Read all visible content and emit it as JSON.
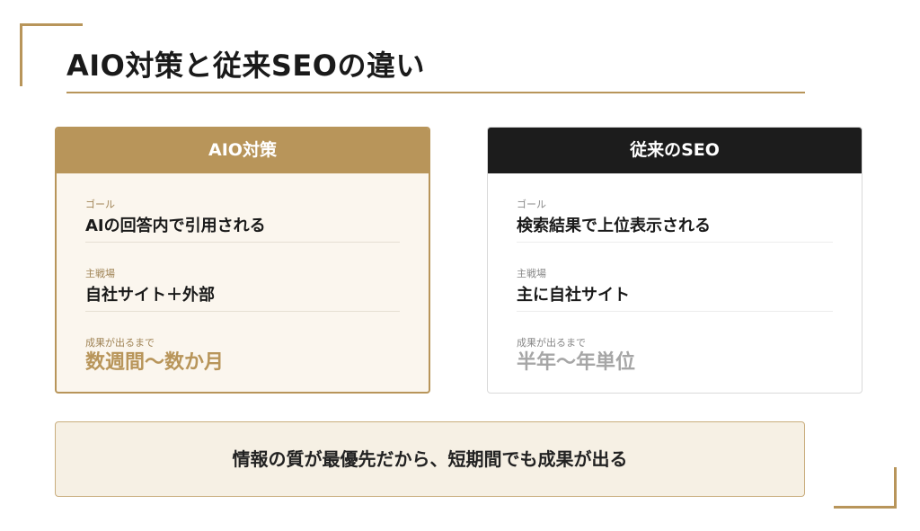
{
  "slide": {
    "title": "AIO対策と従来SEOの違い"
  },
  "cards": {
    "aio": {
      "header": "AIO対策",
      "goal_label": "ゴール",
      "goal_value": "AIの回答内で引用される",
      "field_label": "主戦場",
      "field_value": "自社サイト＋外部",
      "time_label": "成果が出るまで",
      "time_value": "数週間〜数か月"
    },
    "seo": {
      "header": "従来のSEO",
      "goal_label": "ゴール",
      "goal_value": "検索結果で上位表示される",
      "field_label": "主戦場",
      "field_value": "主に自社サイト",
      "time_label": "成果が出るまで",
      "time_value": "半年〜年単位"
    }
  },
  "banner": {
    "text": "情報の質が最優先だから、短期間でも成果が出る"
  },
  "colors": {
    "accent_gold": "#b8955a",
    "dark_header": "#1c1c1c",
    "aio_card_bg": "#fbf6ee",
    "banner_bg": "#f6f0e4",
    "muted_gray": "#a6a6a6"
  }
}
